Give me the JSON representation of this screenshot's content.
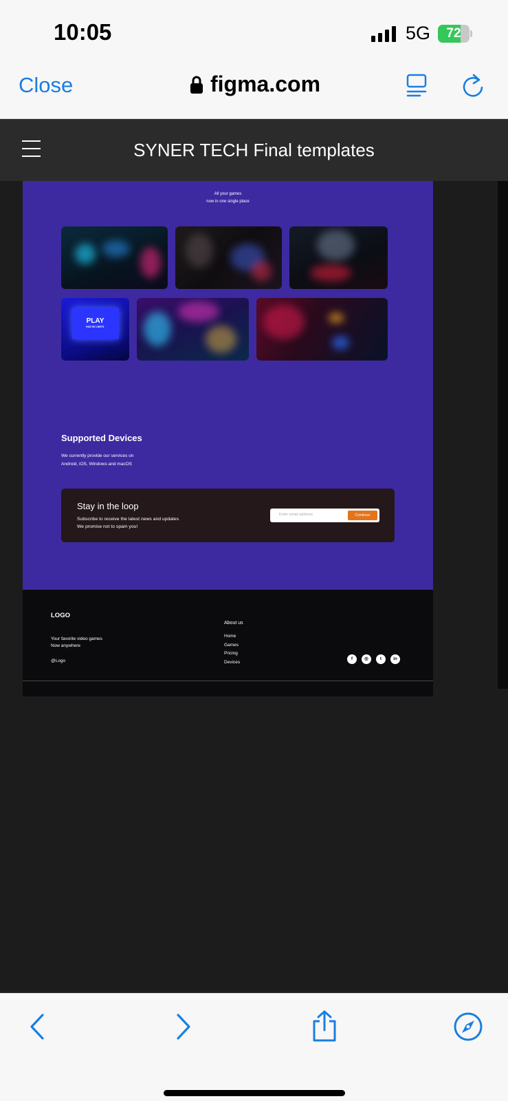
{
  "status_bar": {
    "time": "10:05",
    "network": "5G",
    "battery_level": "72",
    "battery_fraction": 0.72
  },
  "browser": {
    "close_label": "Close",
    "url": "figma.com"
  },
  "figma": {
    "file_title": "SYNER TECH Final templates"
  },
  "design": {
    "tagline_line1": "All your games",
    "tagline_line2": "now in one single place",
    "gallery_tiles": [
      {
        "name": "arcade-room-photo"
      },
      {
        "name": "gamer-setup-photo"
      },
      {
        "name": "pc-hardware-photo"
      },
      {
        "name": "play-screen-photo",
        "text": "PLAY",
        "subtext": "HAS NO LIMITS."
      },
      {
        "name": "neon-arcade-photo"
      },
      {
        "name": "red-arcade-photo"
      }
    ],
    "devices": {
      "title": "Supported Devices",
      "line1": "We currently provide our services on",
      "line2": "Android, iOS, Windows and macOS"
    },
    "newsletter": {
      "title": "Stay in the loop",
      "line1": "Subscribe to receive the latest news and updates",
      "line2": "We promise not to spam you!",
      "email_placeholder": "Enter email address",
      "button_label": "Continue"
    },
    "footer": {
      "logo": "LOGO",
      "tag_line1": "Your favorite video games",
      "tag_line2": "Now anywhere",
      "handle": "@Logo",
      "about_heading": "About us",
      "links": [
        "Home",
        "Games",
        "Pricing",
        "Devices"
      ],
      "socials": [
        {
          "icon": "facebook-icon",
          "glyph": "f"
        },
        {
          "icon": "instagram-icon",
          "glyph": "◎"
        },
        {
          "icon": "twitter-icon",
          "glyph": "t"
        },
        {
          "icon": "linkedin-icon",
          "glyph": "in"
        }
      ]
    }
  },
  "colors": {
    "accent_blue": "#1a7ee0",
    "frame_purple": "#3d2aa1",
    "cta_orange": "#e3741b",
    "battery_green": "#34c759"
  }
}
